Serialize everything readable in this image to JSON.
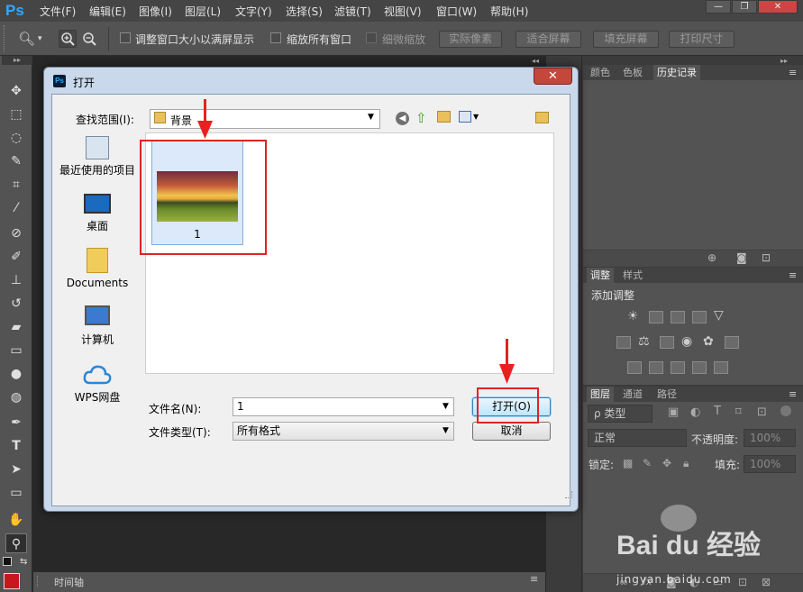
{
  "app": {
    "logo": "Ps",
    "menus": [
      "文件(F)",
      "编辑(E)",
      "图像(I)",
      "图层(L)",
      "文字(Y)",
      "选择(S)",
      "滤镜(T)",
      "视图(V)",
      "窗口(W)",
      "帮助(H)"
    ],
    "window_controls": {
      "minimize": "—",
      "restore": "❐",
      "close": "✕"
    }
  },
  "options_bar": {
    "resize_windows": "调整窗口大小以满屏显示",
    "zoom_all": "缩放所有窗口",
    "scrubby_zoom": "细微缩放",
    "actual_pixels": "实际像素",
    "fit_screen": "适合屏幕",
    "fill_screen": "填充屏幕",
    "print_size": "打印尺寸"
  },
  "panels": {
    "top_tabs": [
      "颜色",
      "色板",
      "历史记录"
    ],
    "adjust_tabs": [
      "调整",
      "样式"
    ],
    "add_adjustment": "添加调整",
    "layers_tabs": [
      "图层",
      "通道",
      "路径"
    ],
    "kind_filter": "ρ 类型",
    "blend_mode": "正常",
    "opacity_label": "不透明度:",
    "opacity_value": "100%",
    "lock_label": "锁定:",
    "fill_label": "填充:",
    "fill_value": "100%"
  },
  "timeline": {
    "label": "时间轴"
  },
  "dialog": {
    "title": "打开",
    "icon": "Ps",
    "look_in_label": "查找范围(I):",
    "look_in_value": "背景",
    "places": [
      "最近使用的项目",
      "桌面",
      "Documents",
      "计算机",
      "WPS网盘"
    ],
    "file_item_name": "1",
    "filename_label": "文件名(N):",
    "filename_value": "1",
    "filetype_label": "文件类型(T):",
    "filetype_value": "所有格式",
    "open_button": "打开(O)",
    "cancel_button": "取消"
  },
  "watermark": {
    "brand": "Bai du 经验",
    "url": "jingyan.baidu.com"
  },
  "colors": {
    "highlight_red": "#e22222",
    "foreground_swatch": "#c8161d",
    "ps_blue": "#31a8ff"
  }
}
